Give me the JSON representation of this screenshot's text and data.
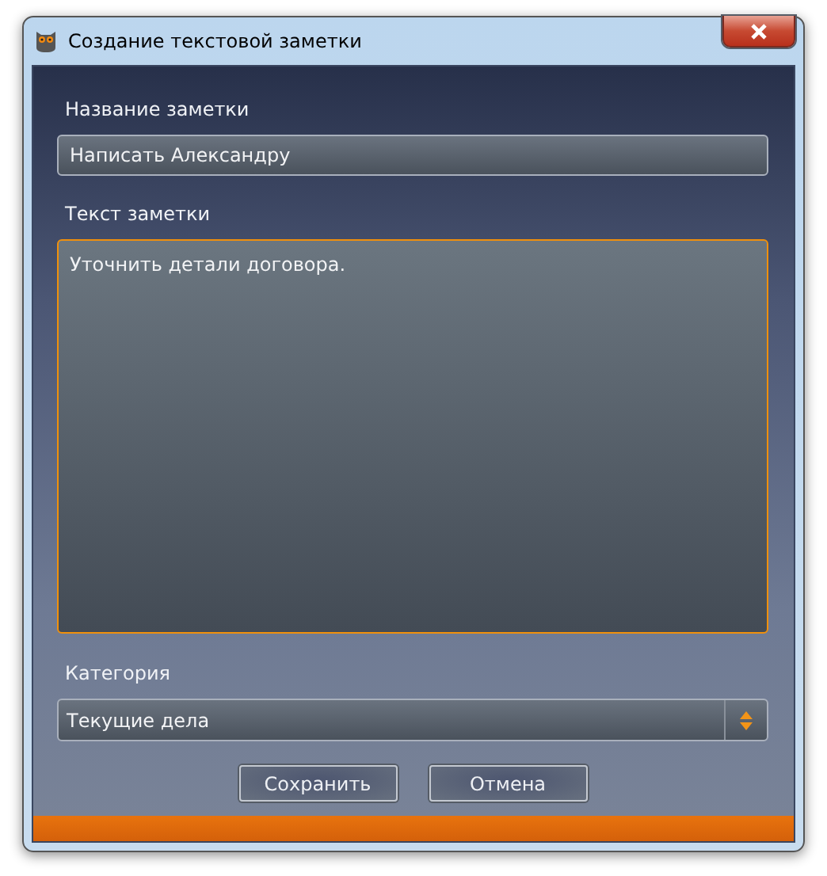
{
  "window": {
    "title": "Создание текстовой заметки"
  },
  "name_field": {
    "label": "Название заметки",
    "value": "Написать Александру"
  },
  "text_field": {
    "label": "Текст заметки",
    "value": "Уточнить детали договора.",
    "focused": true
  },
  "category": {
    "label": "Категория",
    "value": "Текущие дела"
  },
  "buttons": [
    "Сохранить",
    "Отмена"
  ]
}
